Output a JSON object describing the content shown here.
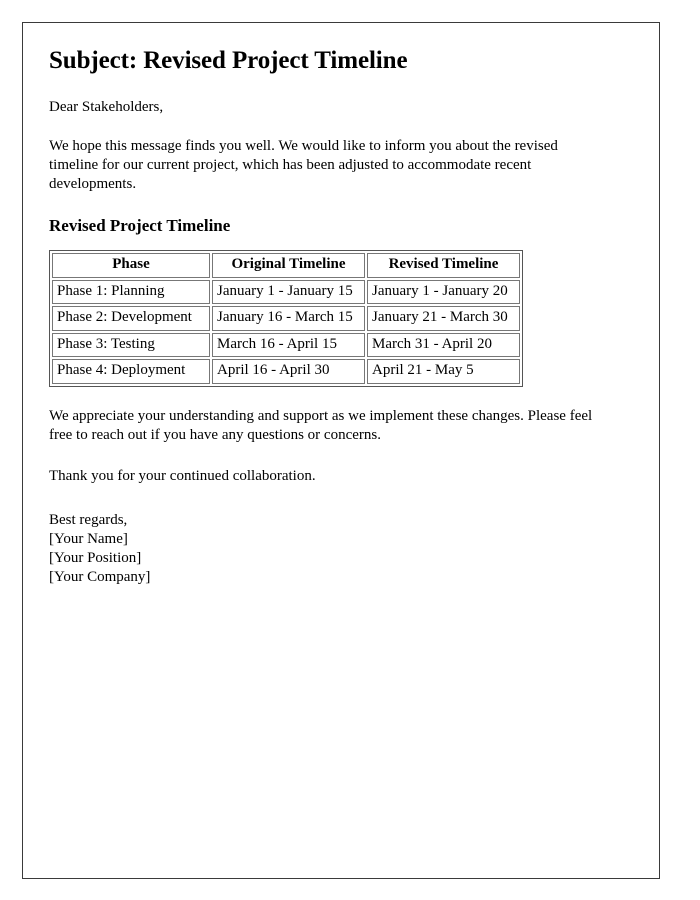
{
  "document": {
    "title": "Subject: Revised Project Timeline",
    "salutation": "Dear Stakeholders,",
    "intro_paragraph": "We hope this message finds you well. We would like to inform you about the revised timeline for our current project, which has been adjusted to accommodate recent developments.",
    "section_heading": "Revised Project Timeline",
    "closing_paragraph": "We appreciate your understanding and support as we implement these changes. Please feel free to reach out if you have any questions or concerns.",
    "thanks_paragraph": "Thank you for your continued collaboration.",
    "signature": {
      "regards": "Best regards,",
      "name": "[Your Name]",
      "position": "[Your Position]",
      "company": "[Your Company]"
    }
  },
  "table": {
    "headers": [
      "Phase",
      "Original Timeline",
      "Revised Timeline"
    ],
    "rows": [
      {
        "phase": "Phase 1: Planning",
        "original": "January 1 - January 15",
        "revised": "January 1 - January 20"
      },
      {
        "phase": "Phase 2: Development",
        "original": "January 16 - March 15",
        "revised": "January 21 - March 30"
      },
      {
        "phase": "Phase 3: Testing",
        "original": "March 16 - April 15",
        "revised": "March 31 - April 20"
      },
      {
        "phase": "Phase 4: Deployment",
        "original": "April 16 - April 30",
        "revised": "April 21 - May 5"
      }
    ]
  },
  "colors": {
    "text": "#000000",
    "background": "#ffffff",
    "page_border": "#3a3a3a",
    "table_border": "#777777"
  }
}
